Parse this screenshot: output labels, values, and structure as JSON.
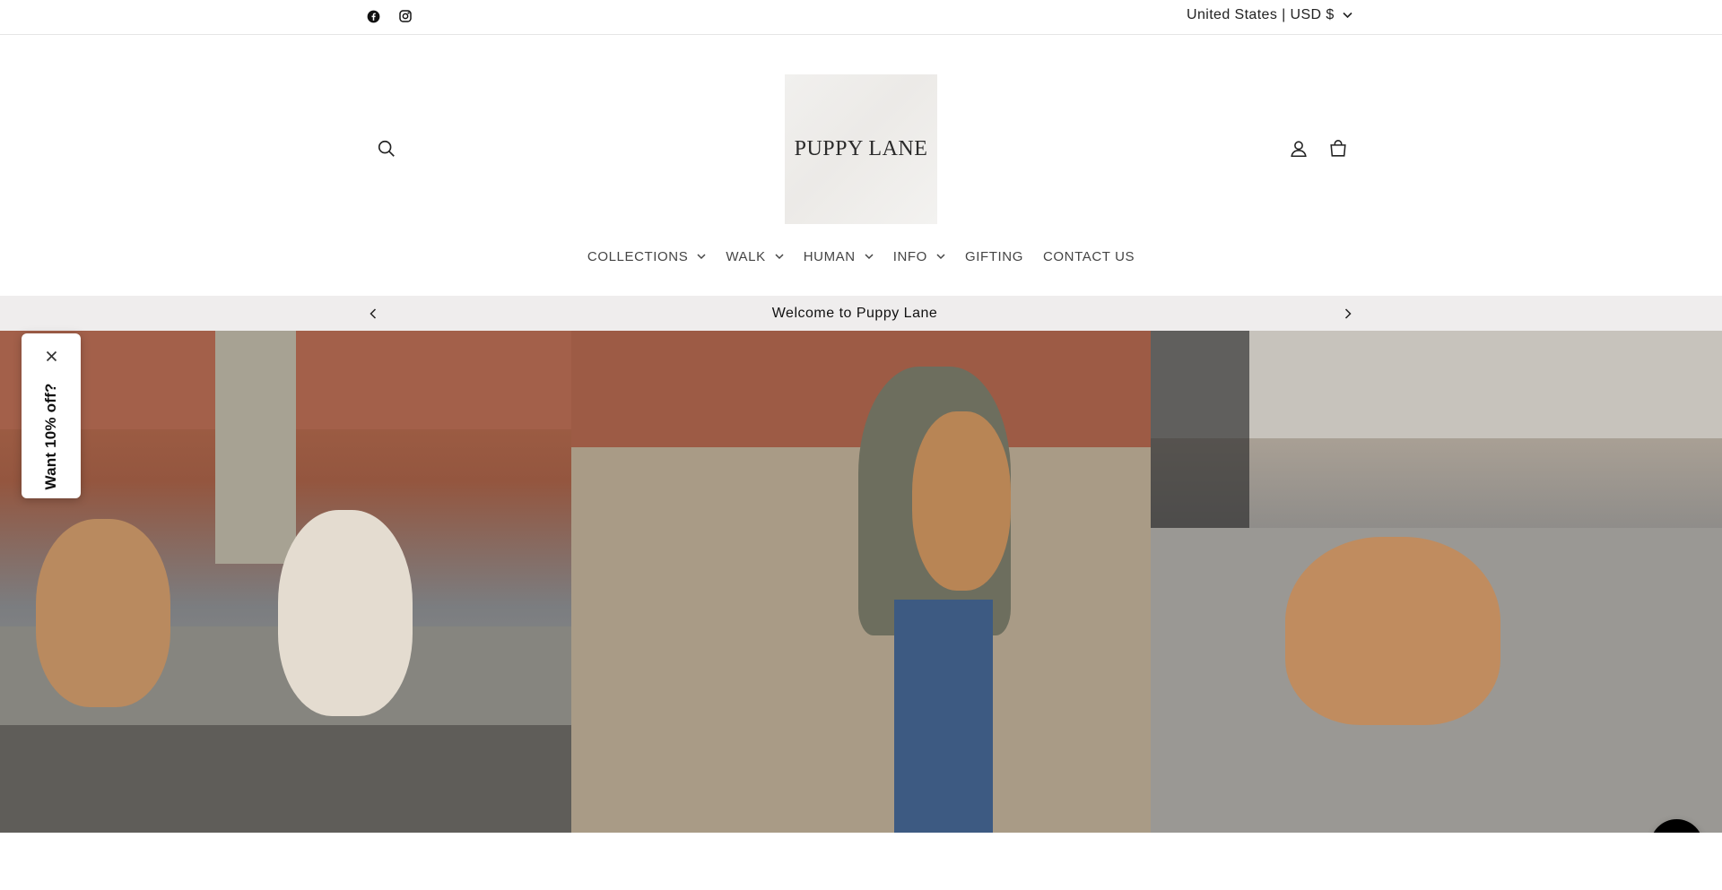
{
  "utility_bar": {
    "social": [
      {
        "name": "facebook",
        "icon": "facebook-icon"
      },
      {
        "name": "instagram",
        "icon": "instagram-icon"
      }
    ],
    "currency_label": "United States | USD $"
  },
  "header": {
    "logo_text": "PUPPY LANE",
    "icons": {
      "search": "search-icon",
      "account": "user-icon",
      "cart": "shopping-bag-icon"
    }
  },
  "nav": {
    "items": [
      {
        "label": "COLLECTIONS",
        "has_dropdown": true
      },
      {
        "label": "WALK",
        "has_dropdown": true
      },
      {
        "label": "HUMAN",
        "has_dropdown": true
      },
      {
        "label": "INFO",
        "has_dropdown": true
      },
      {
        "label": "GIFTING",
        "has_dropdown": false
      },
      {
        "label": "CONTACT US",
        "has_dropdown": false
      }
    ]
  },
  "announcement": {
    "text": "Welcome to Puppy Lane"
  },
  "discount_tab": {
    "label": "Want 10% off?"
  },
  "colors": {
    "announcement_bg": "#efeded",
    "fab_bg": "#000000",
    "text": "#222222"
  }
}
